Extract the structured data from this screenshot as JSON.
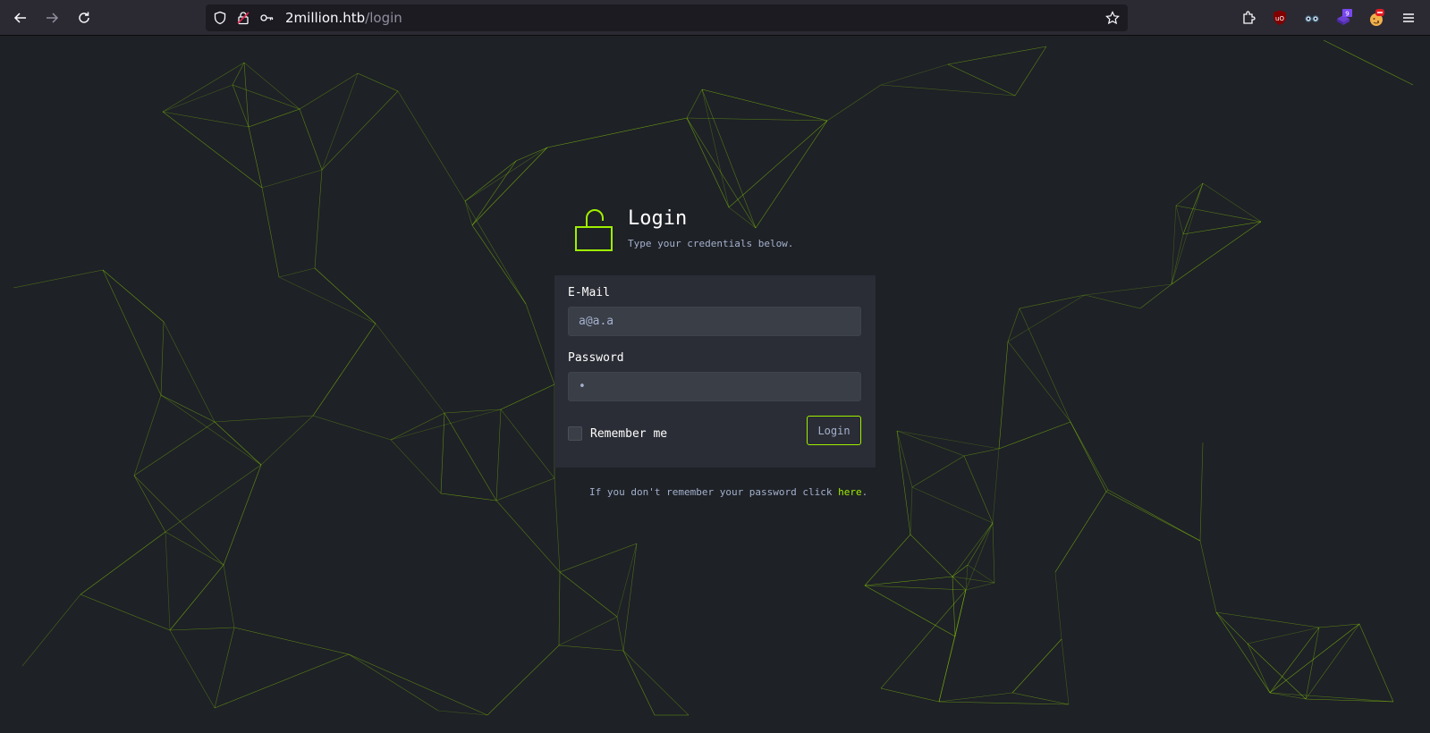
{
  "browser": {
    "url_host": "2million.htb",
    "url_path": "/login",
    "extensions": [
      {
        "name": "ublock-origin-icon",
        "label": "uO"
      },
      {
        "name": "glasses-extension-icon",
        "label": ""
      },
      {
        "name": "purple-box-extension-icon",
        "label": "9"
      },
      {
        "name": "cookie-extension-icon",
        "label": ""
      }
    ]
  },
  "login": {
    "title": "Login",
    "subtitle": "Type your credentials below.",
    "email_label": "E-Mail",
    "email_value": "a@a.a",
    "password_label": "Password",
    "password_value": "•",
    "remember_label": "Remember me",
    "submit_label": "Login",
    "forgot_text": "If you don't remember your password click ",
    "forgot_link": "here",
    "forgot_end": "."
  },
  "colors": {
    "accent": "#9fef00",
    "background": "#1e2126",
    "card": "#2a2d35"
  }
}
